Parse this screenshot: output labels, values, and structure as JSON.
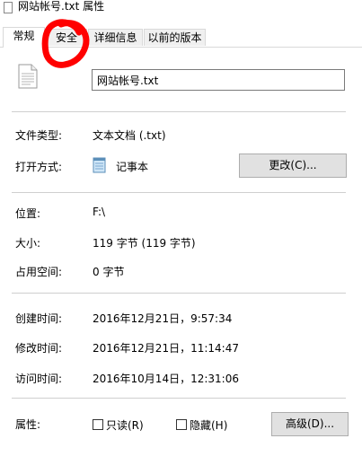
{
  "window": {
    "title": "网站帐号.txt 属性"
  },
  "tabs": [
    {
      "label": "常规"
    },
    {
      "label": "安全"
    },
    {
      "label": "详细信息"
    },
    {
      "label": "以前的版本"
    }
  ],
  "general": {
    "file_name": "网站帐号.txt",
    "file_type": {
      "label": "文件类型:",
      "value": "文本文档 (.txt)"
    },
    "opens_with": {
      "label": "打开方式:",
      "app_name": "记事本",
      "change_button": "更改(C)..."
    },
    "location": {
      "label": "位置:",
      "value": "F:\\"
    },
    "size": {
      "label": "大小:",
      "value": "119 字节 (119 字节)"
    },
    "size_on_disk": {
      "label": "占用空间:",
      "value": "0 字节"
    },
    "created": {
      "label": "创建时间:",
      "value": "2016年12月21日，9:57:34"
    },
    "modified": {
      "label": "修改时间:",
      "value": "2016年12月21日，11:14:47"
    },
    "accessed": {
      "label": "访问时间:",
      "value": "2016年10月14日，12:31:06"
    },
    "attributes": {
      "label": "属性:",
      "readonly": {
        "label": "只读(R)",
        "checked": false
      },
      "hidden": {
        "label": "隐藏(H)",
        "checked": false
      },
      "advanced_button": "高级(D)..."
    }
  },
  "colors": {
    "annotation": "#ff0000"
  }
}
